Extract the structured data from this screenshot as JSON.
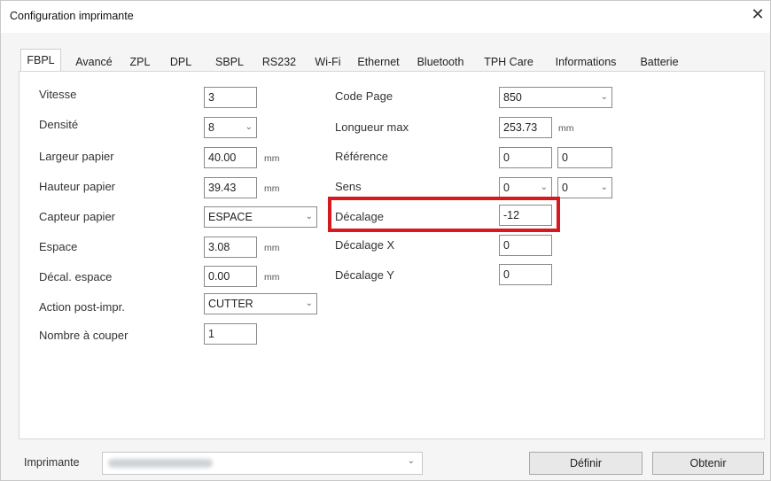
{
  "window": {
    "title": "Configuration imprimante",
    "close_glyph": "✕"
  },
  "tabs": [
    "FBPL",
    "Avancé",
    "ZPL",
    "DPL",
    "SBPL",
    "RS232",
    "Wi-Fi",
    "Ethernet",
    "Bluetooth",
    "TPH Care",
    "Informations",
    "Batterie"
  ],
  "active_tab": "FBPL",
  "left": {
    "vitesse": {
      "label": "Vitesse",
      "value": "3"
    },
    "densite": {
      "label": "Densité",
      "value": "8"
    },
    "largeur": {
      "label": "Largeur papier",
      "value": "40.00",
      "unit": "mm"
    },
    "hauteur": {
      "label": "Hauteur papier",
      "value": "39.43",
      "unit": "mm"
    },
    "capteur": {
      "label": "Capteur papier",
      "value": "ESPACE"
    },
    "espace": {
      "label": "Espace",
      "value": "3.08",
      "unit": "mm"
    },
    "decal_espace": {
      "label": "Décal. espace",
      "value": "0.00",
      "unit": "mm"
    },
    "action": {
      "label": "Action post-impr.",
      "value": "CUTTER"
    },
    "nombre": {
      "label": "Nombre à couper",
      "value": "1"
    }
  },
  "right": {
    "code_page": {
      "label": "Code Page",
      "value": "850"
    },
    "longueur": {
      "label": "Longueur max",
      "value": "253.73",
      "unit": "mm"
    },
    "reference": {
      "label": "Référence",
      "value1": "0",
      "value2": "0"
    },
    "sens": {
      "label": "Sens",
      "value1": "0",
      "value2": "0"
    },
    "decalage": {
      "label": "Décalage",
      "value": "-12"
    },
    "decalage_x": {
      "label": "Décalage X",
      "value": "0"
    },
    "decalage_y": {
      "label": "Décalage Y",
      "value": "0"
    }
  },
  "footer": {
    "printer_label": "Imprimante",
    "definir": "Définir",
    "obtenir": "Obtenir"
  },
  "icons": {
    "chevron": "chevron-down-icon",
    "close": "close-icon"
  },
  "colors": {
    "highlight": "#d6181f"
  }
}
